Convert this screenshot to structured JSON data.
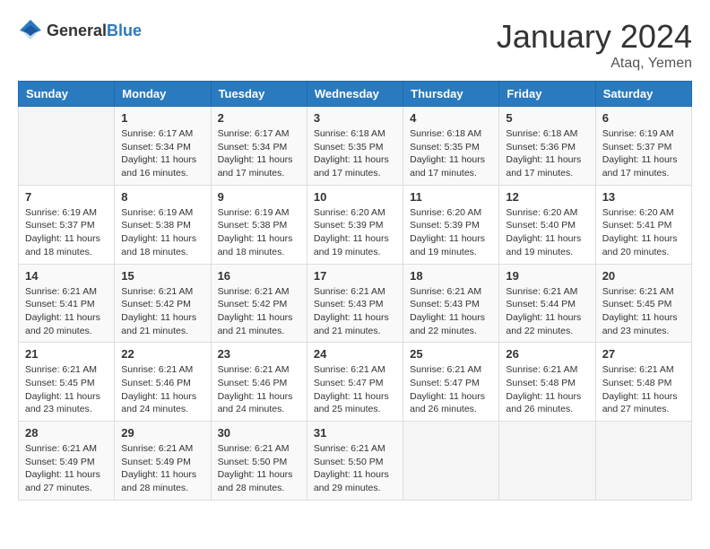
{
  "header": {
    "logo_general": "General",
    "logo_blue": "Blue",
    "month_title": "January 2024",
    "location": "Ataq, Yemen"
  },
  "weekdays": [
    "Sunday",
    "Monday",
    "Tuesday",
    "Wednesday",
    "Thursday",
    "Friday",
    "Saturday"
  ],
  "weeks": [
    [
      {
        "day": "",
        "info": ""
      },
      {
        "day": "1",
        "info": "Sunrise: 6:17 AM\nSunset: 5:34 PM\nDaylight: 11 hours and 16 minutes."
      },
      {
        "day": "2",
        "info": "Sunrise: 6:17 AM\nSunset: 5:34 PM\nDaylight: 11 hours and 17 minutes."
      },
      {
        "day": "3",
        "info": "Sunrise: 6:18 AM\nSunset: 5:35 PM\nDaylight: 11 hours and 17 minutes."
      },
      {
        "day": "4",
        "info": "Sunrise: 6:18 AM\nSunset: 5:35 PM\nDaylight: 11 hours and 17 minutes."
      },
      {
        "day": "5",
        "info": "Sunrise: 6:18 AM\nSunset: 5:36 PM\nDaylight: 11 hours and 17 minutes."
      },
      {
        "day": "6",
        "info": "Sunrise: 6:19 AM\nSunset: 5:37 PM\nDaylight: 11 hours and 17 minutes."
      }
    ],
    [
      {
        "day": "7",
        "info": "Sunrise: 6:19 AM\nSunset: 5:37 PM\nDaylight: 11 hours and 18 minutes."
      },
      {
        "day": "8",
        "info": "Sunrise: 6:19 AM\nSunset: 5:38 PM\nDaylight: 11 hours and 18 minutes."
      },
      {
        "day": "9",
        "info": "Sunrise: 6:19 AM\nSunset: 5:38 PM\nDaylight: 11 hours and 18 minutes."
      },
      {
        "day": "10",
        "info": "Sunrise: 6:20 AM\nSunset: 5:39 PM\nDaylight: 11 hours and 19 minutes."
      },
      {
        "day": "11",
        "info": "Sunrise: 6:20 AM\nSunset: 5:39 PM\nDaylight: 11 hours and 19 minutes."
      },
      {
        "day": "12",
        "info": "Sunrise: 6:20 AM\nSunset: 5:40 PM\nDaylight: 11 hours and 19 minutes."
      },
      {
        "day": "13",
        "info": "Sunrise: 6:20 AM\nSunset: 5:41 PM\nDaylight: 11 hours and 20 minutes."
      }
    ],
    [
      {
        "day": "14",
        "info": "Sunrise: 6:21 AM\nSunset: 5:41 PM\nDaylight: 11 hours and 20 minutes."
      },
      {
        "day": "15",
        "info": "Sunrise: 6:21 AM\nSunset: 5:42 PM\nDaylight: 11 hours and 21 minutes."
      },
      {
        "day": "16",
        "info": "Sunrise: 6:21 AM\nSunset: 5:42 PM\nDaylight: 11 hours and 21 minutes."
      },
      {
        "day": "17",
        "info": "Sunrise: 6:21 AM\nSunset: 5:43 PM\nDaylight: 11 hours and 21 minutes."
      },
      {
        "day": "18",
        "info": "Sunrise: 6:21 AM\nSunset: 5:43 PM\nDaylight: 11 hours and 22 minutes."
      },
      {
        "day": "19",
        "info": "Sunrise: 6:21 AM\nSunset: 5:44 PM\nDaylight: 11 hours and 22 minutes."
      },
      {
        "day": "20",
        "info": "Sunrise: 6:21 AM\nSunset: 5:45 PM\nDaylight: 11 hours and 23 minutes."
      }
    ],
    [
      {
        "day": "21",
        "info": "Sunrise: 6:21 AM\nSunset: 5:45 PM\nDaylight: 11 hours and 23 minutes."
      },
      {
        "day": "22",
        "info": "Sunrise: 6:21 AM\nSunset: 5:46 PM\nDaylight: 11 hours and 24 minutes."
      },
      {
        "day": "23",
        "info": "Sunrise: 6:21 AM\nSunset: 5:46 PM\nDaylight: 11 hours and 24 minutes."
      },
      {
        "day": "24",
        "info": "Sunrise: 6:21 AM\nSunset: 5:47 PM\nDaylight: 11 hours and 25 minutes."
      },
      {
        "day": "25",
        "info": "Sunrise: 6:21 AM\nSunset: 5:47 PM\nDaylight: 11 hours and 26 minutes."
      },
      {
        "day": "26",
        "info": "Sunrise: 6:21 AM\nSunset: 5:48 PM\nDaylight: 11 hours and 26 minutes."
      },
      {
        "day": "27",
        "info": "Sunrise: 6:21 AM\nSunset: 5:48 PM\nDaylight: 11 hours and 27 minutes."
      }
    ],
    [
      {
        "day": "28",
        "info": "Sunrise: 6:21 AM\nSunset: 5:49 PM\nDaylight: 11 hours and 27 minutes."
      },
      {
        "day": "29",
        "info": "Sunrise: 6:21 AM\nSunset: 5:49 PM\nDaylight: 11 hours and 28 minutes."
      },
      {
        "day": "30",
        "info": "Sunrise: 6:21 AM\nSunset: 5:50 PM\nDaylight: 11 hours and 28 minutes."
      },
      {
        "day": "31",
        "info": "Sunrise: 6:21 AM\nSunset: 5:50 PM\nDaylight: 11 hours and 29 minutes."
      },
      {
        "day": "",
        "info": ""
      },
      {
        "day": "",
        "info": ""
      },
      {
        "day": "",
        "info": ""
      }
    ]
  ]
}
